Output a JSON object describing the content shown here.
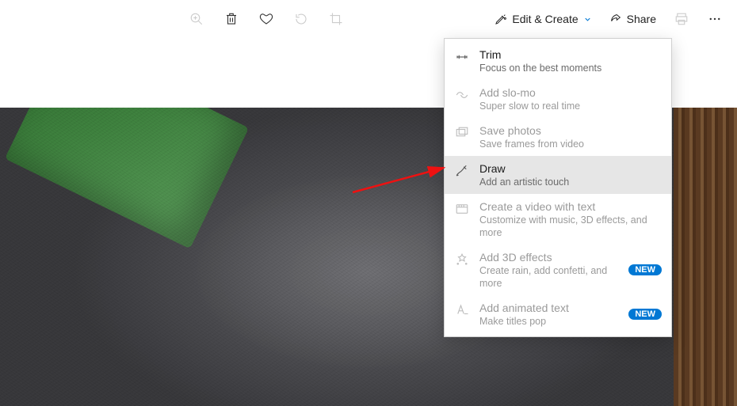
{
  "toolbar": {
    "edit_create_label": "Edit & Create",
    "share_label": "Share"
  },
  "menu": {
    "items": [
      {
        "title": "Trim",
        "subtitle": "Focus on the best moments",
        "icon": "trim-icon",
        "badge": null,
        "disabled": false
      },
      {
        "title": "Add slo-mo",
        "subtitle": "Super slow to real time",
        "icon": "slomo-icon",
        "badge": null,
        "disabled": true
      },
      {
        "title": "Save photos",
        "subtitle": "Save frames from video",
        "icon": "saveframes-icon",
        "badge": null,
        "disabled": true
      },
      {
        "title": "Draw",
        "subtitle": "Add an artistic touch",
        "icon": "draw-icon",
        "badge": null,
        "disabled": false,
        "hover": true
      },
      {
        "title": "Create a video with text",
        "subtitle": "Customize with music, 3D effects, and more",
        "icon": "video-icon",
        "badge": null,
        "disabled": true
      },
      {
        "title": "Add 3D effects",
        "subtitle": "Create rain, add confetti, and more",
        "icon": "effects-icon",
        "badge": "NEW",
        "disabled": true
      },
      {
        "title": "Add animated text",
        "subtitle": "Make titles pop",
        "icon": "animtext-icon",
        "badge": "NEW",
        "disabled": true
      }
    ]
  }
}
